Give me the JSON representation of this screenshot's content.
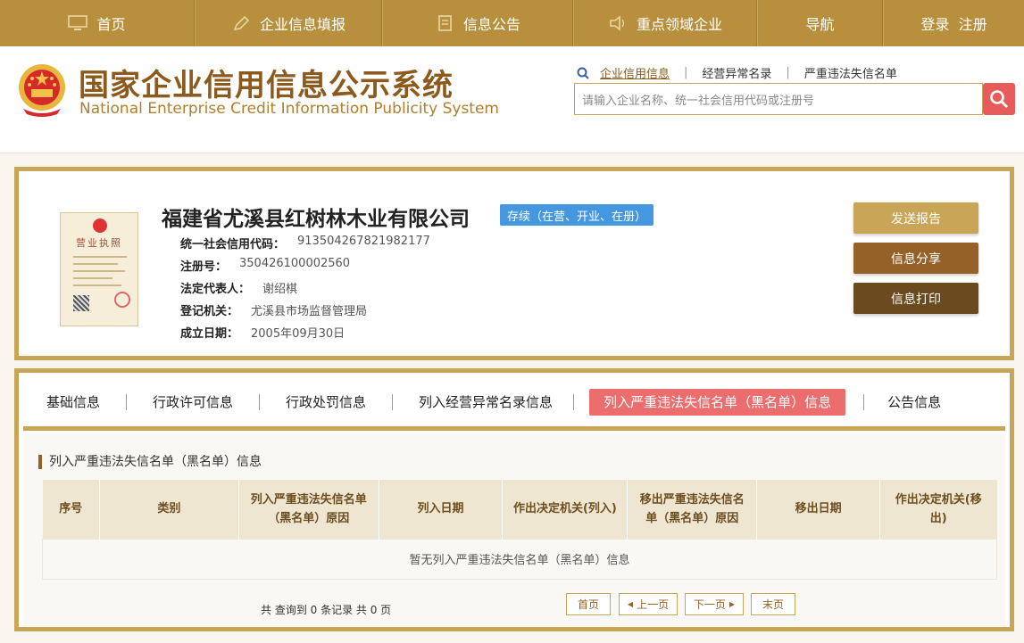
{
  "nav": {
    "items": [
      {
        "label": "首页",
        "icon": "monitor-icon"
      },
      {
        "label": "企业信息填报",
        "icon": "pen-icon"
      },
      {
        "label": "信息公告",
        "icon": "document-icon"
      },
      {
        "label": "重点领域企业",
        "icon": "speaker-icon"
      },
      {
        "label": "导航",
        "icon": ""
      },
      {
        "label": "登录  注册",
        "icon": ""
      }
    ]
  },
  "header": {
    "title_cn": "国家企业信用信息公示系统",
    "title_en": "National Enterprise Credit Information Publicity System",
    "search_tabs": [
      "企业信用信息",
      "经营异常名录",
      "严重违法失信名单"
    ],
    "search_placeholder": "请输入企业名称、统一社会信用代码或注册号"
  },
  "license": {
    "title": "营业执照"
  },
  "company": {
    "name": "福建省尤溪县红树林木业有限公司",
    "status": "存续（在营、开业、在册）",
    "fields": [
      {
        "label": "统一社会信用代码：",
        "value": "913504267821982177"
      },
      {
        "label": "注册号：",
        "value": "350426100002560"
      },
      {
        "label": "法定代表人：",
        "value": "谢绍棋"
      },
      {
        "label": "登记机关：",
        "value": "尤溪县市场监督管理局"
      },
      {
        "label": "成立日期：",
        "value": "2005年09月30日"
      }
    ],
    "actions": {
      "report": "发送报告",
      "share": "信息分享",
      "print": "信息打印"
    }
  },
  "tabs": [
    "基础信息",
    "行政许可信息",
    "行政处罚信息",
    "列入经营异常名录信息",
    "列入严重违法失信名单（黑名单）信息",
    "公告信息"
  ],
  "section": {
    "title": "列入严重违法失信名单（黑名单）信息",
    "columns": [
      "序号",
      "类别",
      "列入严重违法失信名单（黑名单）原因",
      "列入日期",
      "作出决定机关(列入)",
      "移出严重违法失信名单（黑名单）原因",
      "移出日期",
      "作出决定机关(移出)"
    ],
    "empty_text": "暂无列入严重违法失信名单（黑名单）信息",
    "total_text": "共 查询到 0 条记录 共 0 页"
  },
  "pager": {
    "first": "首页",
    "prev": "上一页",
    "next": "下一页",
    "last": "末页"
  }
}
